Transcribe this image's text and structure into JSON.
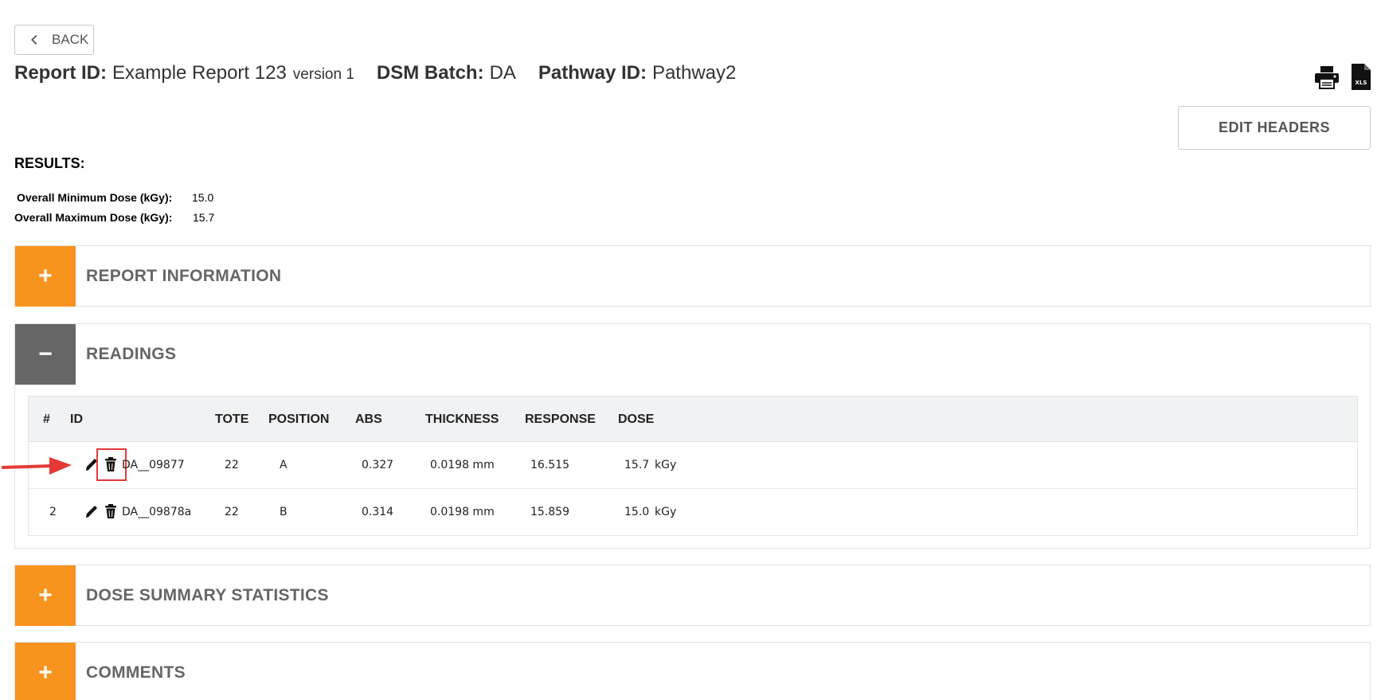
{
  "nav": {
    "back_label": "BACK"
  },
  "header": {
    "report_id_label": "Report ID:",
    "report_id_value": "Example Report 123",
    "version": "version 1",
    "batch_label": "DSM Batch:",
    "batch_value": "DA",
    "pathway_label": "Pathway ID:",
    "pathway_value": "Pathway2"
  },
  "actions": {
    "edit_headers_label": "EDIT HEADERS",
    "xls_label": "XLS"
  },
  "results": {
    "title": "RESULTS:",
    "min_label": "Overall Minimum Dose (kGy):",
    "min_value": "15.0",
    "max_label": "Overall Maximum Dose (kGy):",
    "max_value": "15.7"
  },
  "panels": {
    "report_info": {
      "toggle": "+",
      "title": "REPORT INFORMATION"
    },
    "readings": {
      "toggle": "−",
      "title": "READINGS"
    },
    "dose_summary": {
      "toggle": "+",
      "title": "DOSE SUMMARY STATISTICS"
    },
    "comments": {
      "toggle": "+",
      "title": "COMMENTS"
    }
  },
  "readings_table": {
    "columns": [
      "#",
      "ID",
      "TOTE",
      "POSITION",
      "ABS",
      "THICKNESS",
      "RESPONSE",
      "DOSE"
    ],
    "rows": [
      {
        "num": "",
        "id": "DA__09877",
        "tote": "22",
        "position": "A",
        "abs": "0.327",
        "thickness": "0.0198 mm",
        "response": "16.515",
        "dose": "15.7",
        "unit": "kGy"
      },
      {
        "num": "2",
        "id": "DA__09878a",
        "tote": "22",
        "position": "B",
        "abs": "0.314",
        "thickness": "0.0198 mm",
        "response": "15.859",
        "dose": "15.0",
        "unit": "kGy"
      }
    ]
  },
  "colors": {
    "accent_orange": "#f7941d",
    "collapse_gray": "#666666",
    "annotation_red": "#e03a3a"
  },
  "icons": [
    "chevron-left-icon",
    "printer-icon",
    "xls-file-icon",
    "pencil-icon",
    "trash-icon",
    "annotation-arrow-icon"
  ]
}
